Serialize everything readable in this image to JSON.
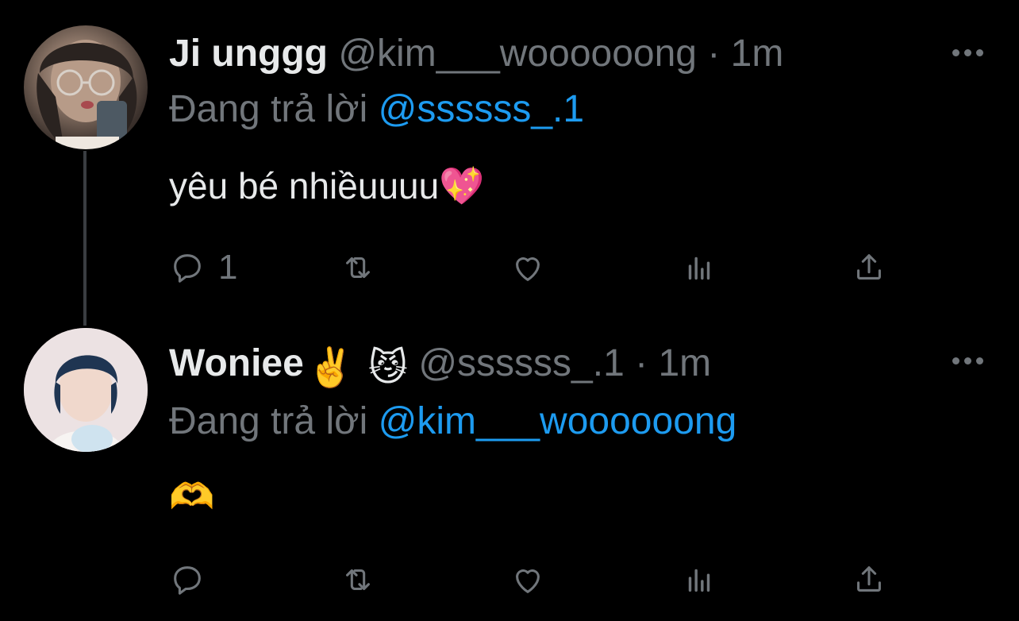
{
  "tweets": [
    {
      "display_name": "Ji unggg",
      "handle": "@kim___woooooong",
      "separator": "·",
      "time": "1m",
      "replying_prefix": "Đang trả lời",
      "replying_to": "@ssssss_.1",
      "text": "yêu bé nhiềuuuu",
      "text_emoji": "💖",
      "reply_count": "1",
      "avatar_icon": "avatar-photo"
    },
    {
      "display_name": "Woniee",
      "name_emojis": [
        "✌️",
        "😼"
      ],
      "handle": "@ssssss_.1",
      "separator": "·",
      "time": "1m",
      "replying_prefix": "Đang trả lời",
      "replying_to": "@kim___woooooong",
      "text": "",
      "text_emoji": "🫶",
      "reply_count": "",
      "avatar_icon": "avatar-photo"
    }
  ],
  "colors": {
    "background": "#000000",
    "primary_text": "#e7e9ea",
    "secondary_text": "#71767b",
    "link": "#1d9bf0",
    "thread_line": "#3a3d41"
  },
  "action_icons": [
    "reply-icon",
    "retweet-icon",
    "like-icon",
    "views-icon",
    "share-icon"
  ]
}
